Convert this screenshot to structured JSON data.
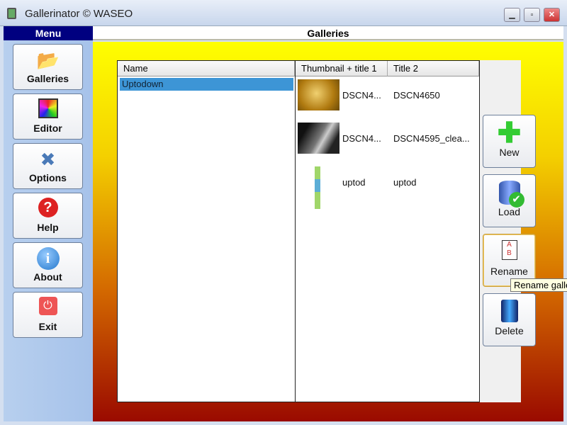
{
  "window": {
    "title": "Gallerinator © WASEO",
    "controls": [
      "minimize",
      "maximize",
      "close"
    ]
  },
  "sidebar": {
    "header": "Menu",
    "items": [
      {
        "label": "Galleries",
        "icon": "folder-icon"
      },
      {
        "label": "Editor",
        "icon": "palette-icon"
      },
      {
        "label": "Options",
        "icon": "tools-icon"
      },
      {
        "label": "Help",
        "icon": "help-icon"
      },
      {
        "label": "About",
        "icon": "info-icon"
      },
      {
        "label": "Exit",
        "icon": "exit-icon"
      }
    ]
  },
  "main": {
    "header": "Galleries",
    "galleries": {
      "column": "Name",
      "items": [
        "Uptodown"
      ],
      "selected": "Uptodown"
    },
    "images": {
      "columns": [
        "Thumbnail + title 1",
        "Title 2"
      ],
      "rows": [
        {
          "title1": "DSCN4...",
          "title2": "DSCN4650"
        },
        {
          "title1": "DSCN4...",
          "title2": "DSCN4595_clea..."
        },
        {
          "title1": "uptod",
          "title2": "uptod"
        }
      ]
    },
    "actions": [
      {
        "label": "New"
      },
      {
        "label": "Load"
      },
      {
        "label": "Rename"
      },
      {
        "label": "Delete"
      }
    ],
    "tooltip": "Rename gallery"
  }
}
